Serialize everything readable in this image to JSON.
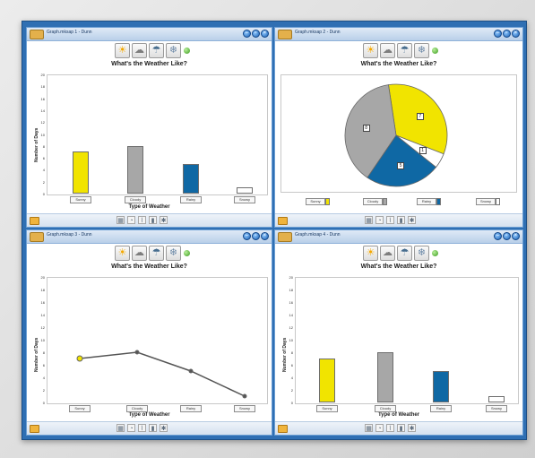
{
  "windows": [
    {
      "id": "w1",
      "title": "Graph.mksap 1 - Dunn"
    },
    {
      "id": "w2",
      "title": "Graph.mksap 2 - Dunn"
    },
    {
      "id": "w3",
      "title": "Graph.mksap 3 - Dunn"
    },
    {
      "id": "w4",
      "title": "Graph.mksap 4 - Dunn"
    }
  ],
  "chart_title": "What's the Weather Like?",
  "y_axis_label": "Number of Days",
  "x_axis_label": "Type of Weather",
  "categories": [
    "Sunny",
    "Cloudy",
    "Rainy",
    "Snowy"
  ],
  "y_ticks": [
    "20",
    "18",
    "16",
    "14",
    "12",
    "10",
    "8",
    "6",
    "4",
    "2",
    "0"
  ],
  "window_buttons": {
    "minimize": "–",
    "maximize": "▫",
    "close": "×"
  },
  "toolbar_icons": [
    "sun-icon",
    "cloud-icon",
    "rain-icon",
    "snow-icon"
  ],
  "pie_labels": [
    "7",
    "8",
    "5",
    "1"
  ],
  "colors": {
    "sunny": "#f1e400",
    "cloudy": "#a7a7a7",
    "rainy": "#0f68a4",
    "snowy": "#ffffff",
    "titlebar_blue": "#2f6fb3"
  },
  "chart_data": [
    {
      "type": "bar",
      "title": "What's the Weather Like?",
      "xlabel": "Type of Weather",
      "ylabel": "Number of Days",
      "categories": [
        "Sunny",
        "Cloudy",
        "Rainy",
        "Snowy"
      ],
      "values": [
        7,
        8,
        5,
        1
      ],
      "ylim": [
        0,
        20
      ]
    },
    {
      "type": "pie",
      "title": "What's the Weather Like?",
      "categories": [
        "Sunny",
        "Cloudy",
        "Rainy",
        "Snowy"
      ],
      "values": [
        7,
        8,
        5,
        1
      ]
    },
    {
      "type": "line",
      "title": "What's the Weather Like?",
      "xlabel": "Type of Weather",
      "ylabel": "Number of Days",
      "categories": [
        "Sunny",
        "Cloudy",
        "Rainy",
        "Snowy"
      ],
      "values": [
        7,
        8,
        5,
        1
      ],
      "ylim": [
        0,
        20
      ]
    },
    {
      "type": "bar",
      "title": "What's the Weather Like?",
      "xlabel": "Type of Weather",
      "ylabel": "Number of Days",
      "categories": [
        "Sunny",
        "Cloudy",
        "Rainy",
        "Snowy"
      ],
      "values": [
        7,
        8,
        5,
        1
      ],
      "ylim": [
        0,
        20
      ]
    }
  ]
}
